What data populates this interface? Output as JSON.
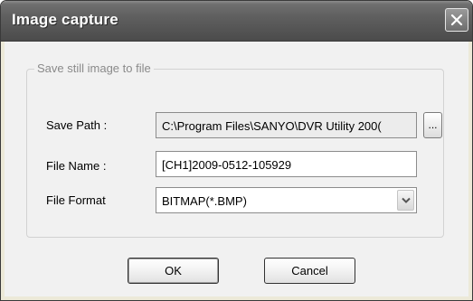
{
  "window": {
    "title": "Image capture",
    "close_icon": "close-x-icon"
  },
  "group": {
    "title": "Save still image to file"
  },
  "save_path": {
    "label": "Save Path :",
    "value": "C:\\Program Files\\SANYO\\DVR Utility 200(",
    "browse_label": "..."
  },
  "file_name": {
    "label": "File Name :",
    "value": "[CH1]2009-0512-105929"
  },
  "file_format": {
    "label": "File Format",
    "selected": "BITMAP(*.BMP)",
    "dropdown_icon": "chevron-down-icon"
  },
  "buttons": {
    "ok_label": "OK",
    "cancel_label": "Cancel"
  }
}
